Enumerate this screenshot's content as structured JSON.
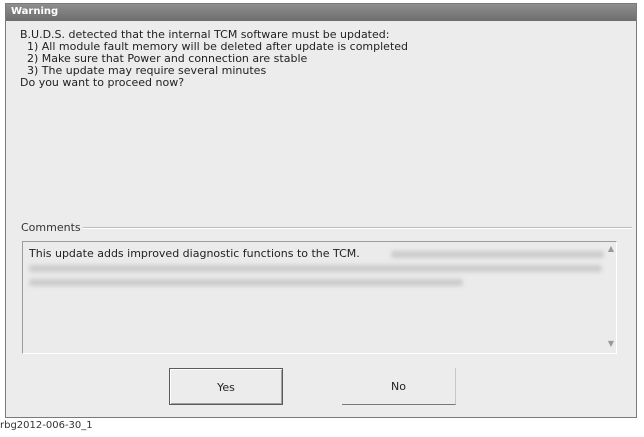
{
  "window": {
    "title": "Warning"
  },
  "message": {
    "lines": [
      "B.U.D.S. detected that the internal TCM software must be updated:",
      "  1) All module fault memory will be deleted after update is completed",
      "  2) Make sure that Power and connection are stable",
      "  3) The update may require several minutes",
      "Do you want to proceed now?"
    ]
  },
  "comments": {
    "label": "Comments",
    "text": "This update adds improved diagnostic functions to the TCM."
  },
  "buttons": {
    "yes": "Yes",
    "no": "No"
  },
  "caption": "rbg2012-006-30_1"
}
